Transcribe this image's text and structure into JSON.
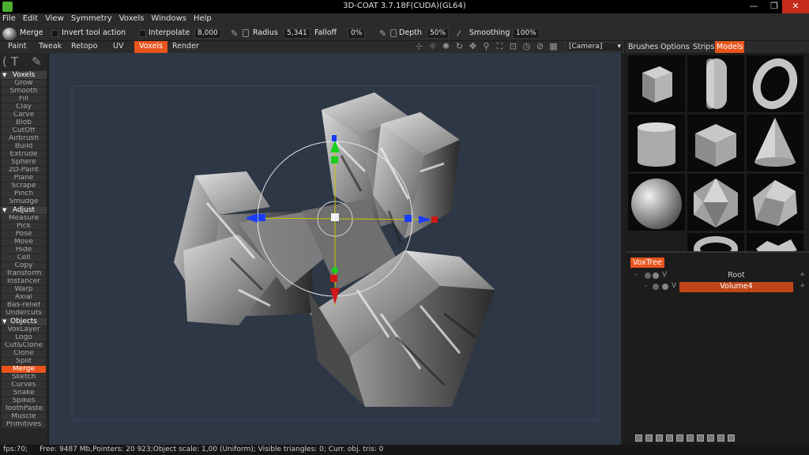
{
  "window": {
    "title": "3D-COAT 3.7.18F(CUDA)(GL64)",
    "min_glyph": "—",
    "max_glyph": "❐",
    "close_glyph": "✕"
  },
  "menu": [
    "File",
    "Edit",
    "View",
    "Symmetry",
    "Voxels",
    "Windows",
    "Help"
  ],
  "tool_options": {
    "tool_name": "Merge",
    "invert_label": "Invert tool action",
    "interpolate_label": "Interpolate",
    "interpolate_value": "8,000",
    "radius_label": "Radius",
    "radius_value": "5,341",
    "falloff_label": "Falloff",
    "falloff_value": "0%",
    "depth_label": "Depth",
    "depth_value": "50%",
    "smoothing_label": "Smoothing",
    "smoothing_value": "100%"
  },
  "rooms": {
    "paint": "Paint",
    "tweak": "Tweak",
    "retopo": "Retopo",
    "uv": "UV",
    "voxels": "Voxels",
    "render": "Render",
    "camera": "[Camera]",
    "camera_arrow": "▾"
  },
  "left_panel": {
    "voxels_header": "Voxels",
    "voxels_tools": [
      "Grow",
      "Smooth",
      "Fill",
      "Clay",
      "Carve",
      "Blob",
      "CutOff",
      "Airbrush",
      "Build",
      "Extrude",
      "Sphere",
      "2D-Paint",
      "Plane",
      "Scrape",
      "Pinch",
      "Smudge"
    ],
    "adjust_header": "Adjust",
    "adjust_tools": [
      "Measure",
      "Pick",
      "Pose",
      "Move",
      "Hide",
      "Cell",
      "Copy",
      "Transform",
      "Instancer",
      "Warp",
      "Axial",
      "Bas-relief",
      "Undercuts"
    ],
    "objects_header": "Objects",
    "objects_tools": [
      "VoxLayer",
      "Logo",
      "Cut&Clone",
      "Clone",
      "Split",
      "Merge",
      "Sketch",
      "Curves",
      "Snake",
      "Spikes",
      "ToothPaste",
      "Muscle",
      "Primitives"
    ],
    "active_tool": "Merge",
    "collapse_glyph": "▼"
  },
  "right_panel": {
    "tabs": {
      "brushes": "Brushes",
      "options": "Options",
      "strips": "Strips",
      "models": "Models"
    },
    "models": [
      "cube",
      "capsule",
      "torus",
      "cylinder",
      "box",
      "cone",
      "sphere",
      "icosahedron",
      "dodecahedron",
      "torus-knot",
      "rock"
    ]
  },
  "voxtree": {
    "tab": "VoxTree",
    "root": {
      "name": "Root",
      "visibility": "V",
      "expand": "-",
      "add": "+"
    },
    "volume": {
      "name": "Volume4",
      "visibility": "V",
      "expand": "-",
      "add": "+",
      "selected": true
    }
  },
  "status": {
    "fps": "fps:70;",
    "info": "Free: 9487 Mb,Pointers: 20 923;Object scale: 1,00 (Uniform); Visible triangles: 0; Curr. obj. tris: 0"
  },
  "colors": {
    "accent": "#e8541c",
    "viewport_bg": "#2e3746",
    "gizmo_x": "#1a3cff",
    "gizmo_y": "#19d01c",
    "gizmo_z": "#d01818"
  }
}
